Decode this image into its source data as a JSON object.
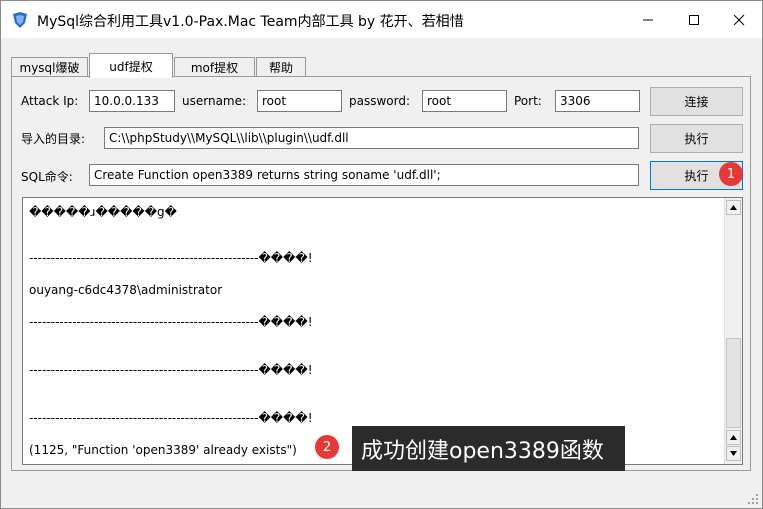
{
  "window": {
    "title": "MySql综合利用工具v1.0-Pax.Mac Team内部工具 by 花开、若相惜",
    "controls": {
      "minimize": "minimize-icon",
      "maximize": "maximize-icon",
      "close": "close-icon"
    }
  },
  "tabs": [
    {
      "label": "mysql爆破"
    },
    {
      "label": "udf提权",
      "active": true
    },
    {
      "label": "mof提权"
    },
    {
      "label": "帮助"
    }
  ],
  "connection": {
    "attack_ip_label": "Attack Ip:",
    "attack_ip_value": "10.0.0.133",
    "username_label": "username:",
    "username_value": "root",
    "password_label": "password:",
    "password_value": "root",
    "port_label": "Port:",
    "port_value": "3306",
    "connect_button": "连接"
  },
  "import_dir": {
    "label": "导入的目录:",
    "value": "C:\\\\phpStudy\\\\MySQL\\\\lib\\\\plugin\\\\udf.dll",
    "execute_button": "执行"
  },
  "sql": {
    "label": "SQL命令:",
    "value": "Create Function open3389 returns string soname 'udf.dll';",
    "execute_button": "执行"
  },
  "output_lines": [
    "�����ɹ�����g�",
    "-----------------------------------------------------����!",
    "ouyang-c6dc4378\\administrator",
    "-----------------------------------------------------����!",
    "-----------------------------------------------------����!",
    "-----------------------------------------------------����!",
    "(1125, \"Function 'open3389' already exists\")"
  ],
  "annotations": {
    "badge_1": "1",
    "badge_2": "2",
    "callout_text": "成功创建open3389函数"
  },
  "colors": {
    "badge": "#e53935",
    "callout_bg": "#2b2b2b",
    "focus_border": "#0078d7"
  }
}
